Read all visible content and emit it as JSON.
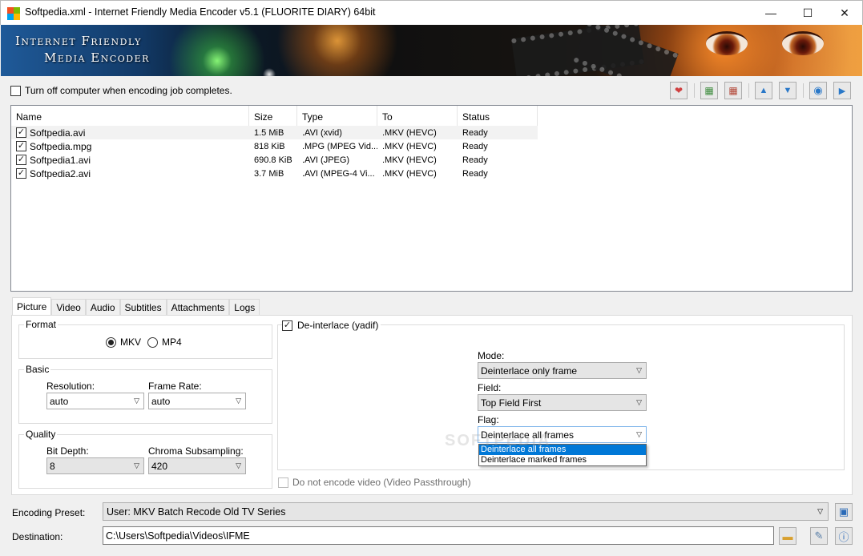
{
  "window": {
    "title": "Softpedia.xml - Internet Friendly Media Encoder v5.1 (FLUORITE DIARY) 64bit",
    "minimize_glyph": "—",
    "maximize_glyph": "☐",
    "close_glyph": "✕"
  },
  "banner": {
    "line1": "Internet Friendly",
    "line2": "Media Encoder"
  },
  "options": {
    "shutdown_label": "Turn off computer when encoding job completes.",
    "shutdown_checked": false
  },
  "toolbar": {
    "icons": [
      "add-job-icon",
      "add-folder-icon",
      "remove-job-icon",
      "move-up-icon",
      "move-down-icon",
      "stop-icon",
      "start-icon"
    ]
  },
  "file_list": {
    "columns": [
      "Name",
      "Size",
      "Type",
      "To",
      "Status"
    ],
    "rows": [
      {
        "checked": true,
        "name": "Softpedia.avi",
        "size": "1.5 MiB",
        "type": ".AVI (xvid)",
        "to": ".MKV (HEVC)",
        "status": "Ready"
      },
      {
        "checked": true,
        "name": "Softpedia.mpg",
        "size": "818 KiB",
        "type": ".MPG (MPEG Vid...",
        "to": ".MKV (HEVC)",
        "status": "Ready"
      },
      {
        "checked": true,
        "name": "Softpedia1.avi",
        "size": "690.8 KiB",
        "type": ".AVI (JPEG)",
        "to": ".MKV (HEVC)",
        "status": "Ready"
      },
      {
        "checked": true,
        "name": "Softpedia2.avi",
        "size": "3.7 MiB",
        "type": ".AVI (MPEG-4 Vi...",
        "to": ".MKV (HEVC)",
        "status": "Ready"
      }
    ]
  },
  "tabs": [
    "Picture",
    "Video",
    "Audio",
    "Subtitles",
    "Attachments",
    "Logs"
  ],
  "active_tab": "Picture",
  "picture": {
    "format": {
      "title": "Format",
      "options": [
        "MKV",
        "MP4"
      ],
      "selected": "MKV"
    },
    "basic": {
      "title": "Basic",
      "resolution_label": "Resolution:",
      "resolution_value": "auto",
      "framerate_label": "Frame Rate:",
      "framerate_value": "auto"
    },
    "quality": {
      "title": "Quality",
      "bitdepth_label": "Bit Depth:",
      "bitdepth_value": "8",
      "chroma_label": "Chroma Subsampling:",
      "chroma_value": "420"
    },
    "deinterlace": {
      "label": "De-interlace (yadif)",
      "checked": true,
      "mode_label": "Mode:",
      "mode_value": "Deinterlace only frame",
      "field_label": "Field:",
      "field_value": "Top Field First",
      "flag_label": "Flag:",
      "flag_value": "Deinterlace all frames",
      "flag_options": [
        "Deinterlace all frames",
        "Deinterlace marked frames"
      ]
    },
    "passthrough_label": "Do not encode video (Video Passthrough)"
  },
  "footer": {
    "preset_label": "Encoding Preset:",
    "preset_value": "User: MKV Batch Recode Old TV Series",
    "destination_label": "Destination:",
    "destination_value": "C:\\Users\\Softpedia\\Videos\\IFME"
  },
  "watermark": "SOFTPEDIA",
  "colors": {
    "selection": "#0078d7",
    "focus_border": "#7eb4ea"
  }
}
